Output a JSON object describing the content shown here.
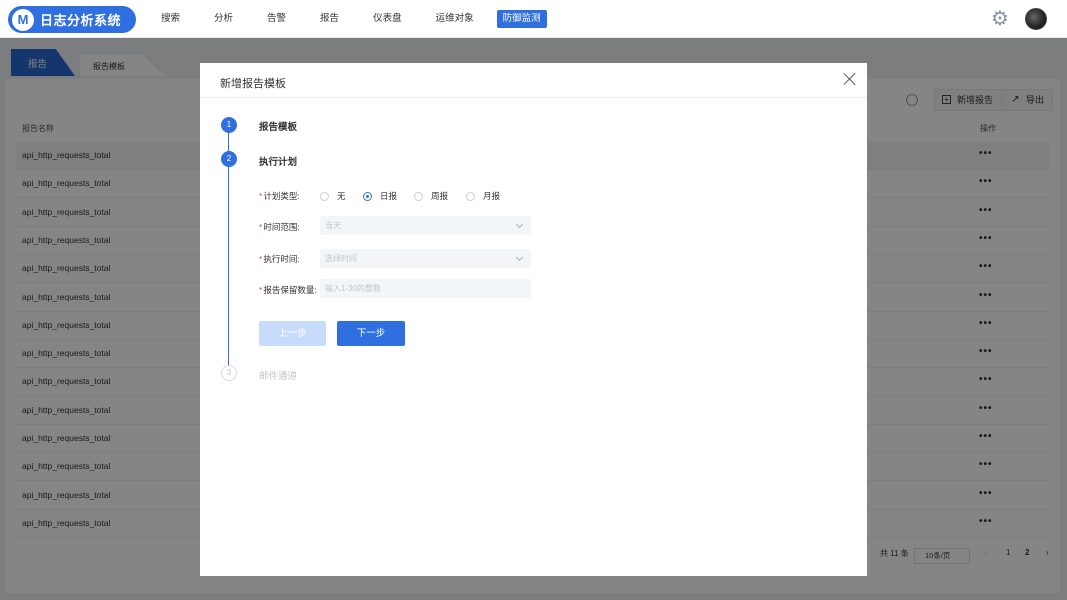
{
  "app": {
    "title": "日志分析系统",
    "logo_glyph": "M"
  },
  "nav": {
    "items": [
      {
        "label": "搜索",
        "active": false
      },
      {
        "label": "分析",
        "active": false
      },
      {
        "label": "告警",
        "active": false
      },
      {
        "label": "报告",
        "active": false
      },
      {
        "label": "仪表盘",
        "active": false
      },
      {
        "label": "运维对象",
        "active": false
      },
      {
        "label": "防御监测",
        "active": true
      }
    ],
    "settings_icon": "gear-icon",
    "settings_glyph": "⚙"
  },
  "page": {
    "tabs": [
      {
        "label": "报告",
        "active": true
      },
      {
        "label": "报告模板",
        "active": false
      }
    ],
    "toolbar": {
      "add_label": "新增报告",
      "add_glyph": "+",
      "export_label": "导出",
      "export_glyph": "↗"
    },
    "table": {
      "headers": {
        "name": "报告名称",
        "action": "操作"
      },
      "more_glyph": "•••",
      "rows": [
        "api_http_requests_total",
        "api_http_requests_total",
        "api_http_requests_total",
        "api_http_requests_total",
        "api_http_requests_total",
        "api_http_requests_total",
        "api_http_requests_total",
        "api_http_requests_total",
        "api_http_requests_total",
        "api_http_requests_total",
        "api_http_requests_total",
        "api_http_requests_total",
        "api_http_requests_total",
        "api_http_requests_total"
      ]
    },
    "pagination": {
      "total": "共 11 条",
      "page_size": "10条/页",
      "prev": "‹",
      "page1": "1",
      "page2": "2",
      "next": "›"
    }
  },
  "modal": {
    "title": "新增报告模板",
    "steps": [
      {
        "num": "1",
        "label": "报告模板",
        "state": "done"
      },
      {
        "num": "2",
        "label": "执行计划",
        "state": "current"
      },
      {
        "num": "3",
        "label": "邮件通道",
        "state": "todo"
      }
    ],
    "form": {
      "required_mark": "*",
      "plan_type_label": "计划类型:",
      "plan_options": [
        {
          "label": "无",
          "selected": false
        },
        {
          "label": "日报",
          "selected": true
        },
        {
          "label": "周报",
          "selected": false
        },
        {
          "label": "月报",
          "selected": false
        }
      ],
      "time_range_label": "时间范围:",
      "time_range_value": "当天",
      "exec_time_label": "执行时间:",
      "exec_time_placeholder": "选择时间",
      "retention_label": "报告保留数量:",
      "retention_placeholder": "输入1-30的整数"
    },
    "buttons": {
      "prev": "上一步",
      "next": "下一步"
    }
  }
}
